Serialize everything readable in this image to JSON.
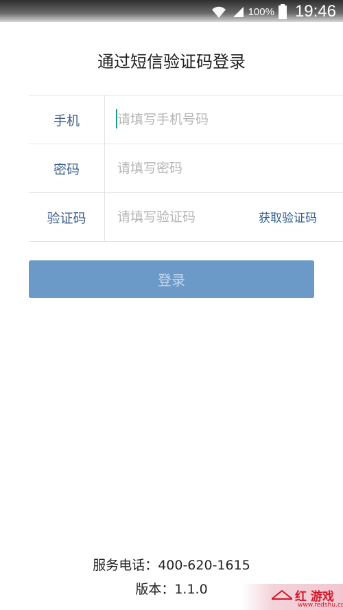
{
  "status_bar": {
    "battery": "100%",
    "time": "19:46"
  },
  "title": "通过短信验证码登录",
  "form": {
    "phone": {
      "label": "手机",
      "placeholder": "请填写手机号码"
    },
    "password": {
      "label": "密码",
      "placeholder": "请填写密码"
    },
    "code": {
      "label": "验证码",
      "placeholder": "请填写验证码",
      "action": "获取验证码"
    }
  },
  "login_button": "登录",
  "footer": {
    "phone": "服务电话：400-620-1615",
    "version": "版本：1.1.0"
  },
  "watermark": {
    "text": "红 游戏",
    "url": "www.redshu.com"
  },
  "colors": {
    "accent": "#3d5f8a",
    "button": "#6b99c8",
    "caret": "#1aa084",
    "watermark": "#d71526"
  }
}
